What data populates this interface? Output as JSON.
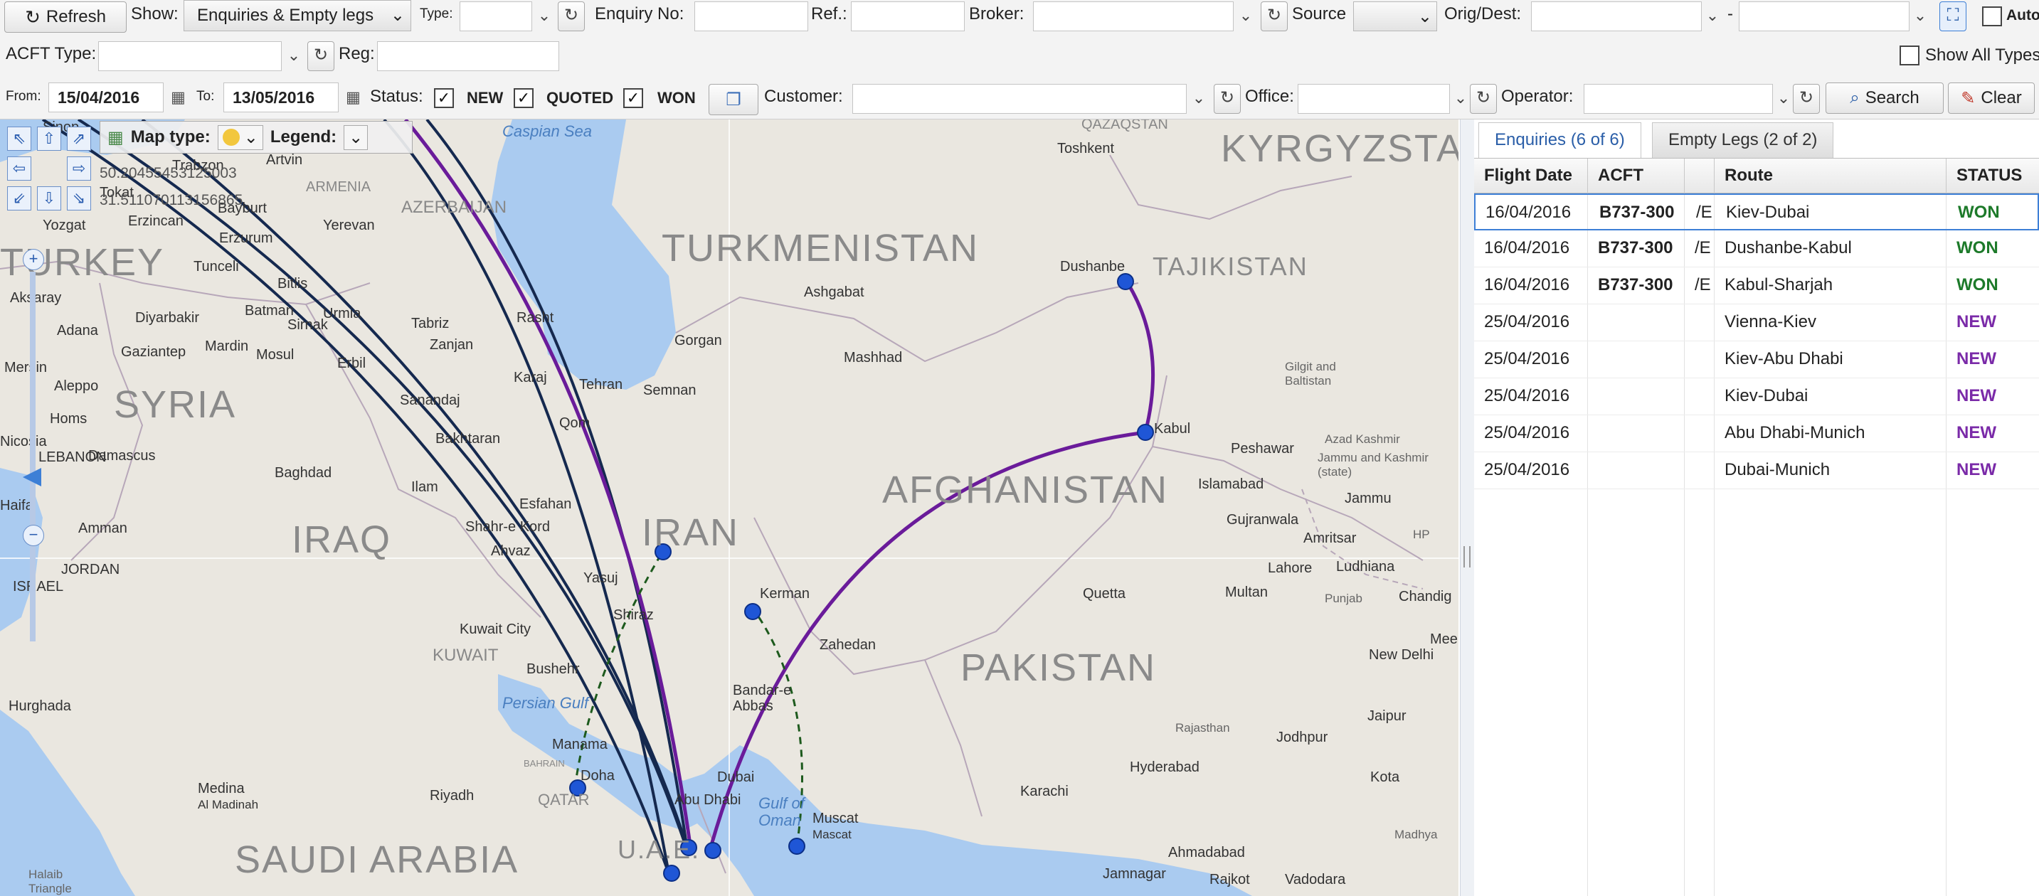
{
  "toolbar": {
    "refresh_label": "Refresh",
    "show_label": "Show:",
    "show_value": "Enquiries & Empty legs",
    "type_label": "Type:",
    "type_value": "",
    "enquiry_no_label": "Enquiry No:",
    "enquiry_no_value": "",
    "ref_label": "Ref.:",
    "ref_value": "",
    "broker_label": "Broker:",
    "broker_value": "",
    "source_label": "Source",
    "source_value": "",
    "origdest_label": "Orig/Dest:",
    "orig_value": "",
    "dash": "-",
    "dest_value": "",
    "auto_label": "Auto",
    "acft_type_label": "ACFT Type:",
    "acft_type_value": "",
    "reg_label": "Reg:",
    "reg_value": "",
    "show_all_types_label": "Show All Types",
    "from_label": "From:",
    "from_value": "15/04/2016",
    "to_label": "To:",
    "to_value": "13/05/2016",
    "status_label": "Status:",
    "status_new": "NEW",
    "status_quoted": "QUOTED",
    "status_won": "WON",
    "customer_label": "Customer:",
    "customer_value": "",
    "office_label": "Office:",
    "office_value": "",
    "operator_label": "Operator:",
    "operator_value": "",
    "search_label": "Search",
    "clear_label": "Clear"
  },
  "map": {
    "map_type_label": "Map type:",
    "legend_label": "Legend:",
    "coord_1": "50.20455453125003",
    "coord_2": "31.511070113156865",
    "countries": [
      "TURKEY",
      "SYRIA",
      "IRAQ",
      "IRAN",
      "TURKMENISTAN",
      "AFGHANISTAN",
      "PAKISTAN",
      "SAUDI ARABIA",
      "KYRGYZSTAN",
      "TAJIKISTAN",
      "U.A.E.",
      "QATAR",
      "KUWAIT",
      "LEBANON",
      "JORDAN",
      "ISRAEL",
      "AZERBAIJAN",
      "ARMENIA",
      "QAZAQSTAN",
      "BAHRAIN"
    ],
    "seas": [
      "Caspian Sea",
      "Persian Gulf",
      "Gulf of Oman"
    ],
    "cities": [
      "Tehran",
      "Qom",
      "Esfahan",
      "Yasuj",
      "Shiraz",
      "Bushehr",
      "Kerman",
      "Zahedan",
      "Bandar-e Abbas",
      "Dubai",
      "Abu Dhabi",
      "Doha",
      "Manama",
      "Muscat",
      "Mascat",
      "Riyadh",
      "Medina",
      "Al Madinah",
      "Hurghada",
      "Baghdad",
      "Damascus",
      "Amman",
      "Aleppo",
      "Homs",
      "Haifa",
      "Adana",
      "Gaziantep",
      "Mardin",
      "Mosul",
      "Erbil",
      "Tabriz",
      "Zanjan",
      "Rasht",
      "Karaj",
      "Semnan",
      "Gorgan",
      "Ashgabat",
      "Mashhad",
      "Dushanbe",
      "Kabul",
      "Peshawar",
      "Islamabad",
      "Gujranwala",
      "Lahore",
      "Amritsar",
      "Ludhiana",
      "Chandig",
      "Jammu",
      "Quetta",
      "Multan",
      "Karachi",
      "Hyderabad",
      "Jodhpur",
      "Jaipur",
      "Kota",
      "New Delhi",
      "Ahmadabad",
      "Rajkot",
      "Vadodara",
      "Jamnagar",
      "Toshkent",
      "Yerevan",
      "Erzurum",
      "Erzincan",
      "Trabzon",
      "Bayburt",
      "Tokat",
      "Yozgat",
      "Diyarbakir",
      "Batman",
      "Sirnak",
      "Bitlis",
      "Urmia",
      "Tunceli",
      "Kuwait City",
      "Sanandaj",
      "Bakhtaran",
      "Ilam",
      "Shahr-e Kord",
      "Ahvaz",
      "Nicosia",
      "Mersin",
      "Gilgit and Baltistan",
      "Azad Kashmir",
      "Jammu and Kashmir (state)",
      "Punjab",
      "HP",
      "Rajasthan",
      "Madhya",
      "Halaib Triangle",
      "Aksaray",
      "Meer",
      "Artvin",
      "Sinop"
    ]
  },
  "tabs": [
    {
      "label": "Enquiries (6 of 6)"
    },
    {
      "label": "Empty Legs (2 of 2)"
    }
  ],
  "grid": {
    "headers": [
      "Flight Date",
      "ACFT",
      "",
      "Route",
      "STATUS"
    ],
    "rows": [
      {
        "date": "16/04/2016",
        "acft": "B737-300",
        "extra": "/E",
        "route": "Kiev-Dubai",
        "status": "WON"
      },
      {
        "date": "16/04/2016",
        "acft": "B737-300",
        "extra": "/E",
        "route": "Dushanbe-Kabul",
        "status": "WON"
      },
      {
        "date": "16/04/2016",
        "acft": "B737-300",
        "extra": "/E",
        "route": "Kabul-Sharjah",
        "status": "WON"
      },
      {
        "date": "25/04/2016",
        "acft": "",
        "extra": "",
        "route": "Vienna-Kiev",
        "status": "NEW"
      },
      {
        "date": "25/04/2016",
        "acft": "",
        "extra": "",
        "route": "Kiev-Abu Dhabi",
        "status": "NEW"
      },
      {
        "date": "25/04/2016",
        "acft": "",
        "extra": "",
        "route": "Kiev-Dubai",
        "status": "NEW"
      },
      {
        "date": "25/04/2016",
        "acft": "",
        "extra": "",
        "route": "Abu Dhabi-Munich",
        "status": "NEW"
      },
      {
        "date": "25/04/2016",
        "acft": "",
        "extra": "",
        "route": "Dubai-Munich",
        "status": "NEW"
      }
    ]
  },
  "colors": {
    "won": "#1d7a2a",
    "new": "#7a2aa8",
    "route_navy": "#15294f",
    "route_purple": "#6a1b9a",
    "empty_leg": "#1d5a1d",
    "marker": "#1f56d6"
  }
}
